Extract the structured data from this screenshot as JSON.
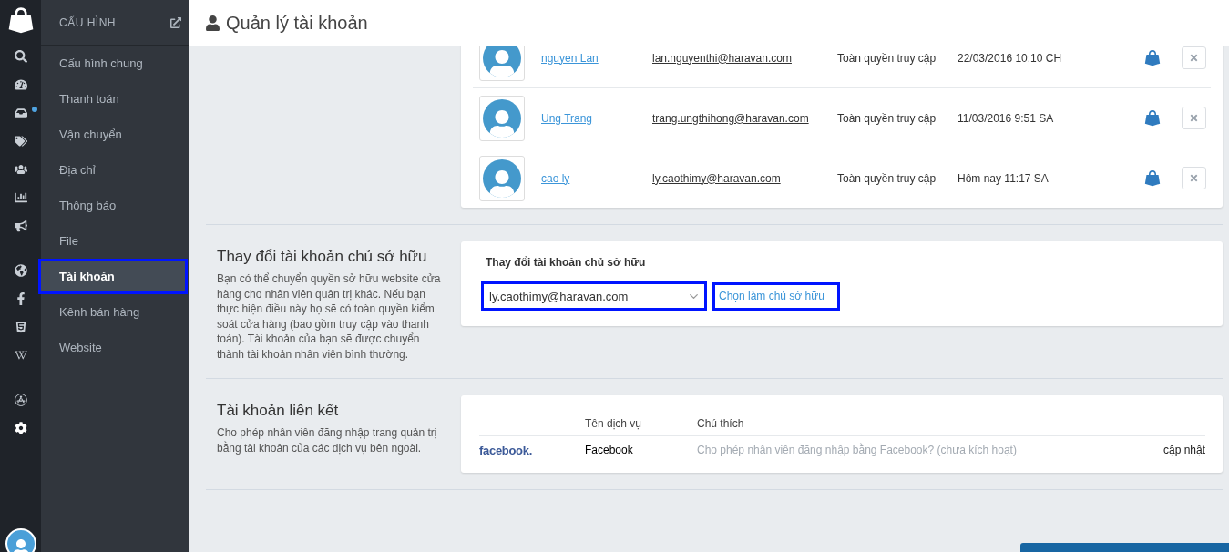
{
  "rail": {
    "inbox_unread": true
  },
  "nav": {
    "title": "CẤU HÌNH",
    "items": [
      {
        "label": "Cấu hình chung",
        "selected": false,
        "highlighted": false
      },
      {
        "label": "Thanh toán",
        "selected": false,
        "highlighted": false
      },
      {
        "label": "Vận chuyển",
        "selected": false,
        "highlighted": false
      },
      {
        "label": "Địa chỉ",
        "selected": false,
        "highlighted": false
      },
      {
        "label": "Thông báo",
        "selected": false,
        "highlighted": false
      },
      {
        "label": "File",
        "selected": false,
        "highlighted": false
      },
      {
        "label": "Tài khoản",
        "selected": true,
        "highlighted": true
      },
      {
        "label": "Kênh bán hàng",
        "selected": false,
        "highlighted": false
      },
      {
        "label": "Website",
        "selected": false,
        "highlighted": false
      }
    ]
  },
  "page_title": "Quản lý tài khoản",
  "users": {
    "rows": [
      {
        "name": "nguyen Lan",
        "email": "lan.nguyenthi@haravan.com",
        "access": "Toàn quyền truy cập",
        "last_login": "22/03/2016 10:10 CH"
      },
      {
        "name": "Ung Trang",
        "email": "trang.ungthihong@haravan.com",
        "access": "Toàn quyền truy cập",
        "last_login": "11/03/2016 9:51 SA"
      },
      {
        "name": "cao ly",
        "email": "ly.caothimy@haravan.com",
        "access": "Toàn quyền truy cập",
        "last_login": "Hôm nay 11:17 SA"
      }
    ]
  },
  "owner_section": {
    "title": "Thay đổi tài khoản chủ sở hữu",
    "description": "Bạn có thể chuyển quyền sở hữu website cửa hàng cho nhân viên quản trị khác. Nếu bạn thực hiện điều này họ sẽ có toàn quyền kiểm soát cửa hàng (bao gồm truy cập vào thanh toán). Tài khoản của bạn sẽ được chuyển thành tài khoản nhân viên bình thường.",
    "card_title": "Thay đổi tài khoản chủ sở hữu",
    "select": {
      "value": "ly.caothimy@haravan.com",
      "highlighted": true
    },
    "link": {
      "label": "Chọn làm chủ sở hữu",
      "highlighted": true
    }
  },
  "linked_section": {
    "title": "Tài khoản liên kết",
    "description": "Cho phép nhân viên đăng nhập trang quản trị bằng tài khoản của các dịch vụ bên ngoài.",
    "columns": [
      "Tên dịch vụ",
      "Chú thích"
    ],
    "rows": [
      {
        "logo": "facebook.",
        "service": "Facebook",
        "note": "Cho phép nhân viên đăng nhập bằng Facebook? (chưa kích hoạt)",
        "action": "cập nhật"
      }
    ]
  }
}
